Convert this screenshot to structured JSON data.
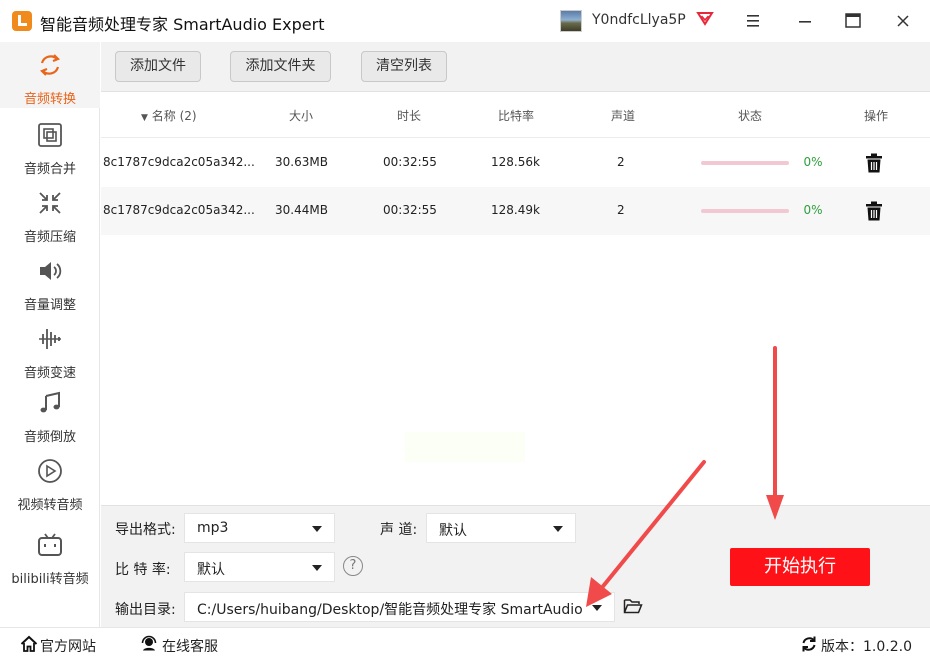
{
  "app": {
    "title": "智能音频处理专家 SmartAudio Expert",
    "username": "Y0ndfcLlya5P"
  },
  "sidebar": {
    "items": [
      {
        "label": "音频转换",
        "icon": "refresh-convert-icon",
        "active": true
      },
      {
        "label": "音频合并",
        "icon": "merge-icon",
        "active": false
      },
      {
        "label": "音频压缩",
        "icon": "compress-icon",
        "active": false
      },
      {
        "label": "音量调整",
        "icon": "volume-icon",
        "active": false
      },
      {
        "label": "音频变速",
        "icon": "waveform-icon",
        "active": false
      },
      {
        "label": "音频倒放",
        "icon": "music-note-icon",
        "active": false
      },
      {
        "label": "视频转音频",
        "icon": "play-circle-icon",
        "active": false
      },
      {
        "label": "bilibili转音频",
        "icon": "bilibili-tv-icon",
        "active": false
      }
    ]
  },
  "toolbar": {
    "add_file": "添加文件",
    "add_folder": "添加文件夹",
    "clear_list": "清空列表"
  },
  "table": {
    "headers": {
      "name": "名称 (2)",
      "size": "大小",
      "duration": "时长",
      "bitrate": "比特率",
      "channels": "声道",
      "status": "状态",
      "action": "操作"
    },
    "rows": [
      {
        "name": "8c1787c9dca2c05a342...",
        "size": "30.63MB",
        "duration": "00:32:55",
        "bitrate": "128.56k",
        "channels": "2",
        "progress": 0,
        "progress_text": "0%"
      },
      {
        "name": "8c1787c9dca2c05a342...",
        "size": "30.44MB",
        "duration": "00:32:55",
        "bitrate": "128.49k",
        "channels": "2",
        "progress": 0,
        "progress_text": "0%"
      }
    ]
  },
  "options": {
    "format_label": "导出格式:",
    "format_value": "mp3",
    "channel_label": "声 道:",
    "channel_value": "默认",
    "bitrate_label": "比 特 率:",
    "bitrate_value": "默认",
    "help_glyph": "?",
    "output_label": "输出目录:",
    "output_value": "C:/Users/huibang/Desktop/智能音频处理专家 SmartAudio",
    "start_button": "开始执行"
  },
  "statusbar": {
    "website": "官方网站",
    "support": "在线客服",
    "version": "版本：1.0.2.0"
  },
  "colors": {
    "accent": "#e8651a",
    "start": "#fe1217",
    "progress_track": "#f2c8d2",
    "progress_text": "#2e9e3e",
    "arrow": "#f04a4a"
  }
}
